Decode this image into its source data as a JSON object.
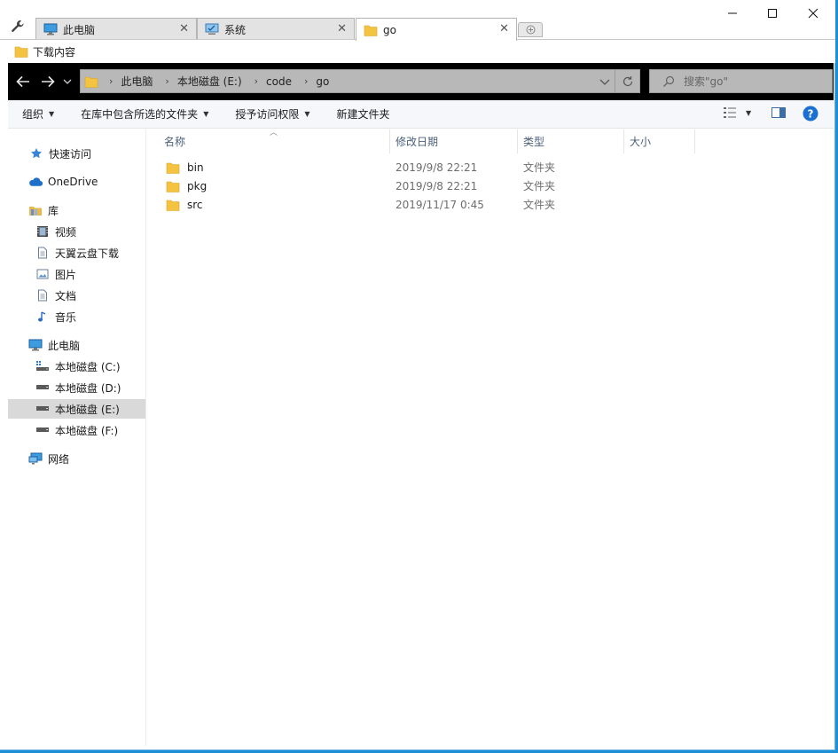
{
  "tabs": [
    {
      "label": "此电脑",
      "icon": "computer-icon"
    },
    {
      "label": "系统",
      "icon": "system-icon"
    },
    {
      "label": "go",
      "icon": "folder-icon",
      "active": true
    }
  ],
  "favorites": [
    {
      "label": "下载内容",
      "icon": "folder-icon"
    }
  ],
  "address": {
    "crumbs": [
      "此电脑",
      "本地磁盘 (E:)",
      "code",
      "go"
    ]
  },
  "search": {
    "placeholder": "搜索\"go\""
  },
  "commands": [
    {
      "label": "组织"
    },
    {
      "label": "在库中包含所选的文件夹"
    },
    {
      "label": "授予访问权限"
    },
    {
      "label": "新建文件夹"
    }
  ],
  "nav": {
    "quick_access": "快速访问",
    "onedrive": "OneDrive",
    "library": "库",
    "library_items": [
      "视频",
      "天翼云盘下载",
      "图片",
      "文档",
      "音乐"
    ],
    "this_pc": "此电脑",
    "drives": [
      "本地磁盘 (C:)",
      "本地磁盘 (D:)",
      "本地磁盘 (E:)",
      "本地磁盘 (F:)"
    ],
    "network": "网络"
  },
  "columns": {
    "name": "名称",
    "date": "修改日期",
    "type": "类型",
    "size": "大小"
  },
  "files": [
    {
      "name": "bin",
      "date": "2019/9/8 22:21",
      "type": "文件夹"
    },
    {
      "name": "pkg",
      "date": "2019/9/8 22:21",
      "type": "文件夹"
    },
    {
      "name": "src",
      "date": "2019/11/17 0:45",
      "type": "文件夹"
    }
  ],
  "colors": {
    "accent": "#1d8fd6",
    "folder": "#f5c342",
    "selected": "#d9d9d9"
  }
}
